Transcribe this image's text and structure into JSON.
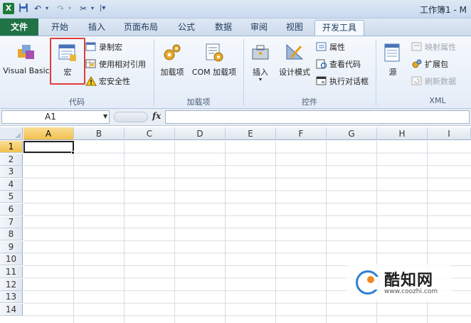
{
  "window": {
    "title": "工作簿1 - M"
  },
  "tabs": {
    "file": "文件",
    "home": "开始",
    "insert": "插入",
    "layout": "页面布局",
    "formula": "公式",
    "data": "数据",
    "review": "审阅",
    "view": "视图",
    "developer": "开发工具"
  },
  "ribbon": {
    "code": {
      "label": "代码",
      "visual_basic": "Visual Basic",
      "macro": "宏",
      "record_macro": "录制宏",
      "relative_ref": "使用相对引用",
      "macro_security": "宏安全性"
    },
    "addins": {
      "label": "加载项",
      "addins": "加载项",
      "com_addins": "COM 加载项"
    },
    "controls": {
      "label": "控件",
      "insert": "插入",
      "design_mode": "设计模式",
      "properties": "属性",
      "view_code": "查看代码",
      "run_dialog": "执行对话框"
    },
    "xml": {
      "label": "XML",
      "source": "源",
      "map_properties": "映射属性",
      "expansion_packs": "扩展包",
      "refresh_data": "刷新数据"
    }
  },
  "formula_bar": {
    "name_box": "A1",
    "fx": "fx",
    "value": ""
  },
  "grid": {
    "columns": [
      "A",
      "B",
      "C",
      "D",
      "E",
      "F",
      "G",
      "H",
      "I"
    ],
    "rows": [
      "1",
      "2",
      "3",
      "4",
      "5",
      "6",
      "7",
      "8",
      "9",
      "10",
      "11",
      "12",
      "13",
      "14"
    ],
    "active_cell": "A1"
  },
  "watermark": {
    "name": "酷知网",
    "url": "www.coozhi.com"
  },
  "colors": {
    "file_tab": "#217346",
    "highlight": "#e23b3b",
    "active_header": "#f2c04b"
  }
}
